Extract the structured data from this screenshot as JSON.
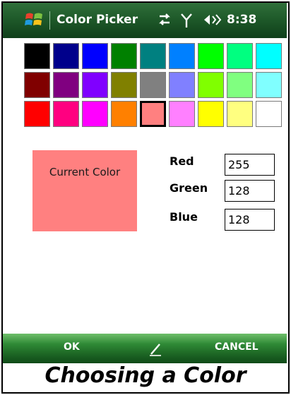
{
  "titlebar": {
    "app_title": "Color Picker",
    "clock": "8:38"
  },
  "palette": {
    "colors": [
      "#000000",
      "#00008b",
      "#0000ff",
      "#008000",
      "#008080",
      "#0080ff",
      "#00ff00",
      "#00ff80",
      "#00ffff",
      "#800000",
      "#800080",
      "#8000ff",
      "#808000",
      "#808080",
      "#8080ff",
      "#80ff00",
      "#80ff80",
      "#80ffff",
      "#ff0000",
      "#ff0080",
      "#ff00ff",
      "#ff8000",
      "#ff8080",
      "#ff80ff",
      "#ffff00",
      "#ffff80",
      "#ffffff"
    ],
    "selected_index": 22
  },
  "current": {
    "label": "Current Color",
    "color": "#ff8080"
  },
  "rgb": {
    "red_label": "Red",
    "green_label": "Green",
    "blue_label": "Blue",
    "red_value": "255",
    "green_value": "128",
    "blue_value": "128"
  },
  "softkeys": {
    "left_label": "OK",
    "right_label": "CANCEL"
  },
  "caption": "Choosing a Color"
}
